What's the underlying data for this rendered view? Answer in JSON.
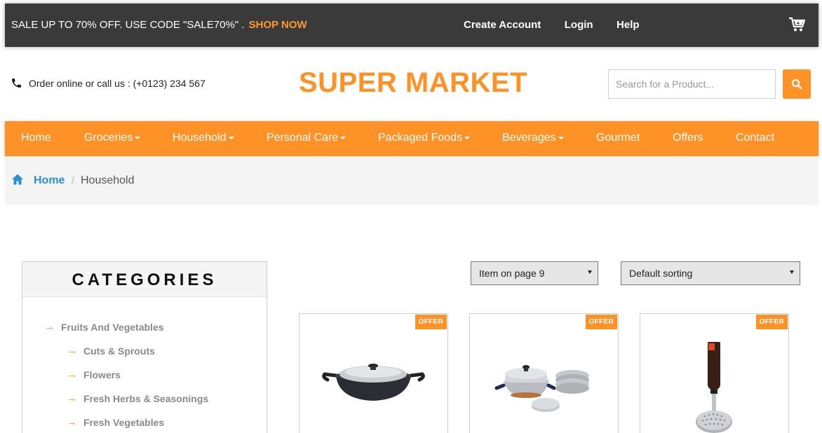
{
  "topbar": {
    "promo_text": "SALE UP TO 70% OFF. USE CODE \"SALE70%\" .",
    "shop_now": "SHOP NOW",
    "links": [
      "Create Account",
      "Login",
      "Help"
    ],
    "cart_icon": "cart-icon"
  },
  "header": {
    "phone_text": "Order online or call us : (+0123) 234 567",
    "logo": "SUPER MARKET",
    "search_placeholder": "Search for a Product...",
    "search_icon": "search-icon"
  },
  "nav": {
    "items": [
      {
        "label": "Home",
        "dropdown": false
      },
      {
        "label": "Groceries",
        "dropdown": true
      },
      {
        "label": "Household",
        "dropdown": true
      },
      {
        "label": "Personal Care",
        "dropdown": true
      },
      {
        "label": "Packaged Foods",
        "dropdown": true
      },
      {
        "label": "Beverages",
        "dropdown": true
      },
      {
        "label": "Gourmet",
        "dropdown": false
      },
      {
        "label": "Offers",
        "dropdown": false
      },
      {
        "label": "Contact",
        "dropdown": false
      }
    ]
  },
  "breadcrumb": {
    "home": "Home",
    "separator": "/",
    "current": "Household"
  },
  "sidebar": {
    "title": "CATEGORIES",
    "items": [
      "Fruits And Vegetables",
      "Cuts & Sprouts",
      "Flowers",
      "Fresh Herbs & Seasonings",
      "Fresh Vegetables"
    ]
  },
  "sorting": {
    "items_per_page": "Item on page 9",
    "sort_by": "Default sorting"
  },
  "products": [
    {
      "badge": "OFFER",
      "image": "kadai-pan"
    },
    {
      "badge": "OFFER",
      "image": "idli-maker-set"
    },
    {
      "badge": "OFFER",
      "image": "potato-masher"
    }
  ],
  "colors": {
    "accent": "#ff9226",
    "topbar_bg": "#3a3a3a",
    "link_blue": "#2b8fd0"
  }
}
